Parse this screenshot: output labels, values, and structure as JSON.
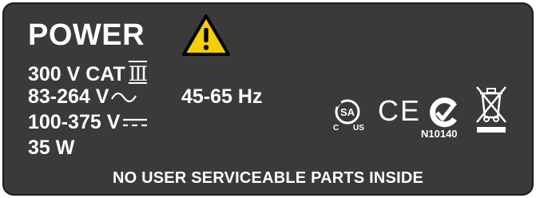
{
  "label": {
    "title": "POWER",
    "category": "300 V CAT",
    "category_roman": "Ⅲ",
    "ac_range": "83-264 V",
    "frequency": "45-65 Hz",
    "dc_range": "100-375 V",
    "wattage": "35 W",
    "footer": "NO USER SERVICEABLE PARTS INSIDE"
  },
  "certifications": {
    "csa_left": "C",
    "csa_right": "US",
    "ce": "CE",
    "ctick_code": "N10140"
  },
  "icons": {
    "warning": "warning-triangle-icon",
    "ac": "ac-current-icon",
    "dc": "dc-current-icon",
    "csa": "csa-mark-icon",
    "ctick": "c-tick-icon",
    "weee": "weee-crossed-bin-icon"
  },
  "colors": {
    "label_background": "#3a3a3a",
    "text": "#ffffff",
    "warning_fill": "#f5d000",
    "warning_outline": "#000000"
  }
}
